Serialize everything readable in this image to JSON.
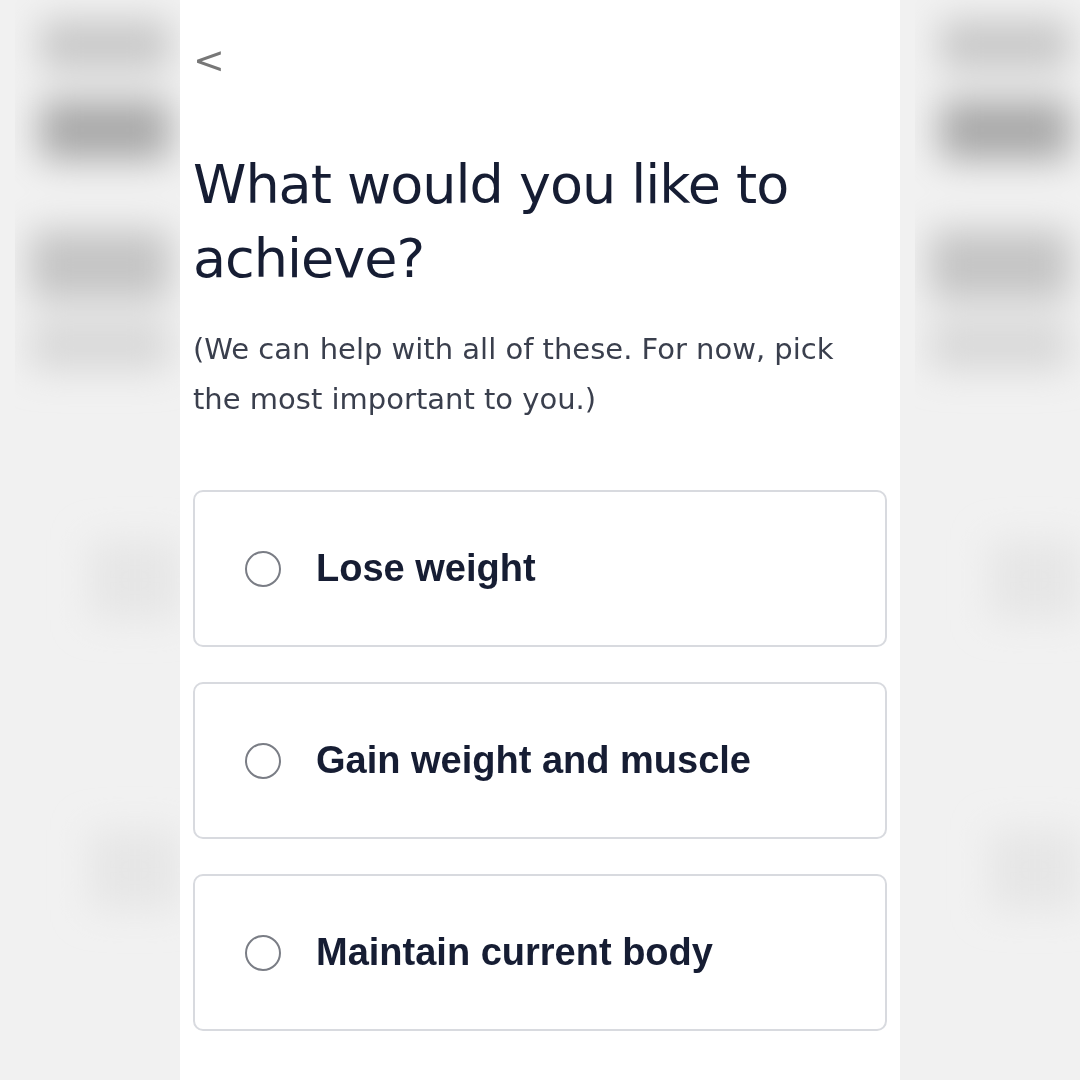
{
  "header": {
    "back": "<"
  },
  "title": "What would you like to achieve?",
  "subtitle": "(We can help with all of these. For now, pick the most important to you.)",
  "options": [
    {
      "label": "Lose weight",
      "selected": false
    },
    {
      "label": "Gain weight and muscle",
      "selected": false
    },
    {
      "label": "Maintain current body",
      "selected": false
    }
  ]
}
